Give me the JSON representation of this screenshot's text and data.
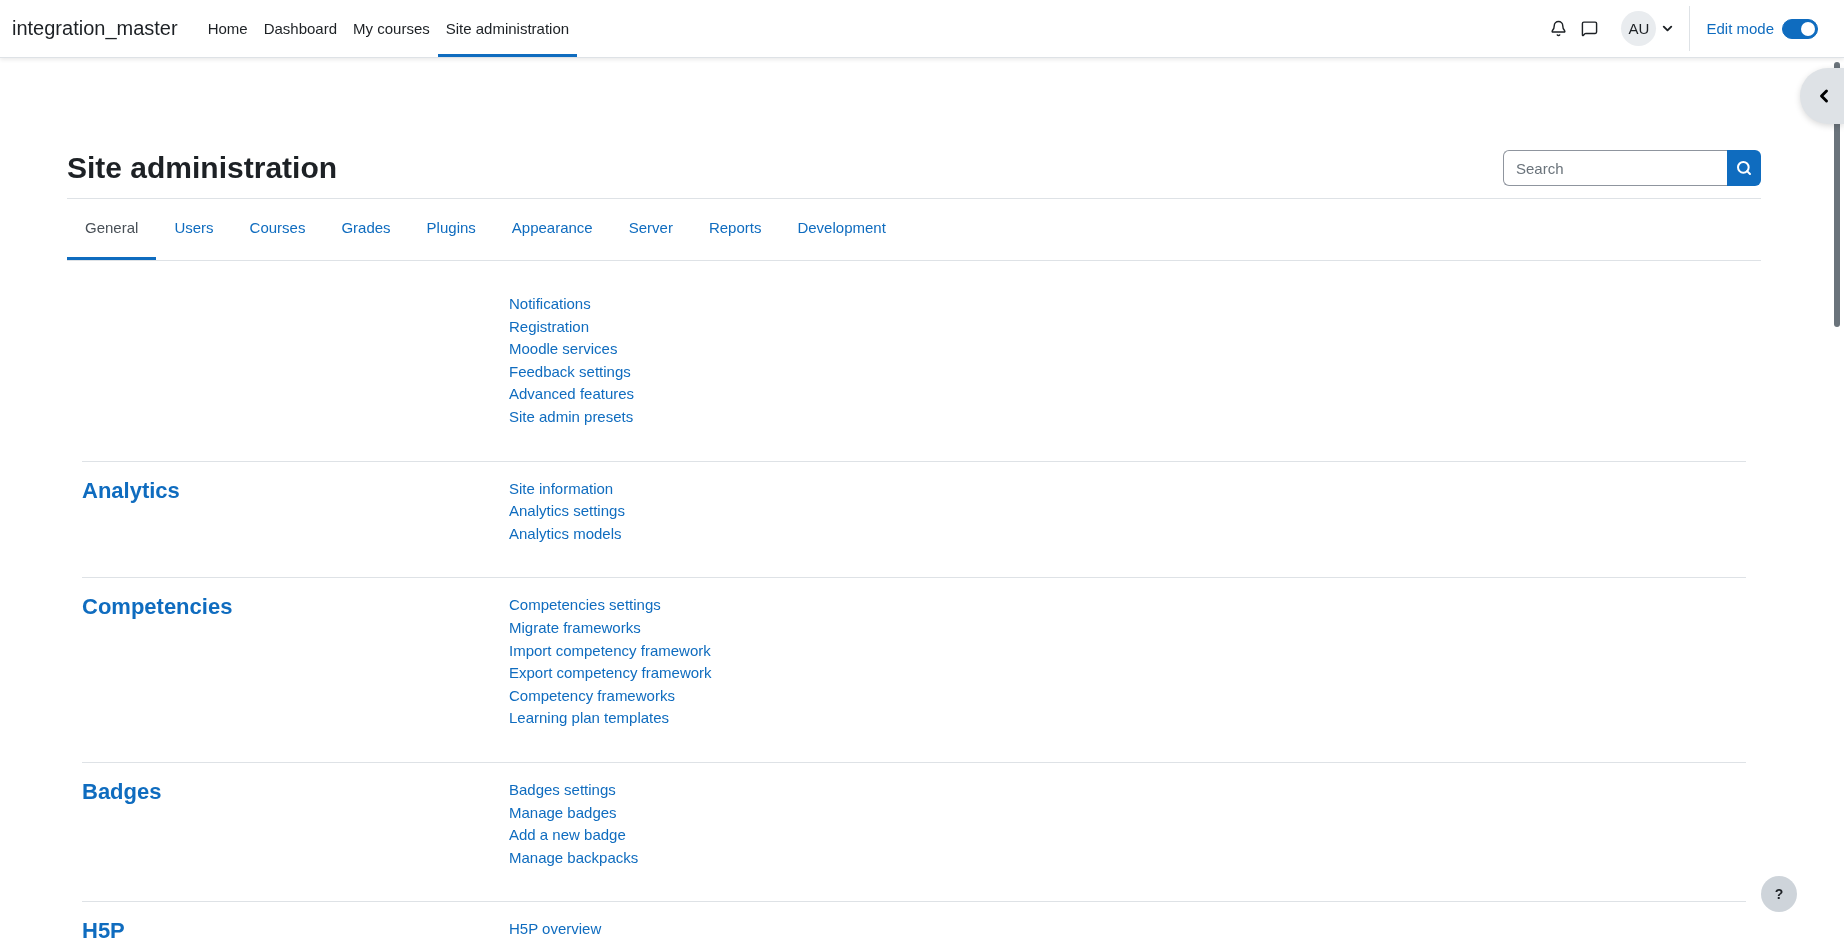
{
  "navbar": {
    "brand": "integration_master",
    "items": [
      {
        "label": "Home",
        "selected": false
      },
      {
        "label": "Dashboard",
        "selected": false
      },
      {
        "label": "My courses",
        "selected": false
      },
      {
        "label": "Site administration",
        "selected": true
      }
    ],
    "avatar": "AU",
    "edit_mode": {
      "label": "Edit mode",
      "on": true
    }
  },
  "page": {
    "title": "Site administration",
    "search": {
      "placeholder": "Search"
    },
    "tabs": [
      {
        "label": "General",
        "selected": true
      },
      {
        "label": "Users",
        "selected": false
      },
      {
        "label": "Courses",
        "selected": false
      },
      {
        "label": "Grades",
        "selected": false
      },
      {
        "label": "Plugins",
        "selected": false
      },
      {
        "label": "Appearance",
        "selected": false
      },
      {
        "label": "Server",
        "selected": false
      },
      {
        "label": "Reports",
        "selected": false
      },
      {
        "label": "Development",
        "selected": false
      }
    ],
    "sections": [
      {
        "links": [
          "Notifications",
          "Registration",
          "Moodle services",
          "Feedback settings",
          "Advanced features",
          "Site admin presets"
        ]
      },
      {
        "heading": "Analytics",
        "links": [
          "Site information",
          "Analytics settings",
          "Analytics models"
        ]
      },
      {
        "heading": "Competencies",
        "links": [
          "Competencies settings",
          "Migrate frameworks",
          "Import competency framework",
          "Export competency framework",
          "Competency frameworks",
          "Learning plan templates"
        ]
      },
      {
        "heading": "Badges",
        "links": [
          "Badges settings",
          "Manage badges",
          "Add a new badge",
          "Manage backpacks"
        ]
      },
      {
        "heading": "H5P",
        "links": [
          "H5P overview"
        ]
      }
    ]
  },
  "help_button": "?"
}
